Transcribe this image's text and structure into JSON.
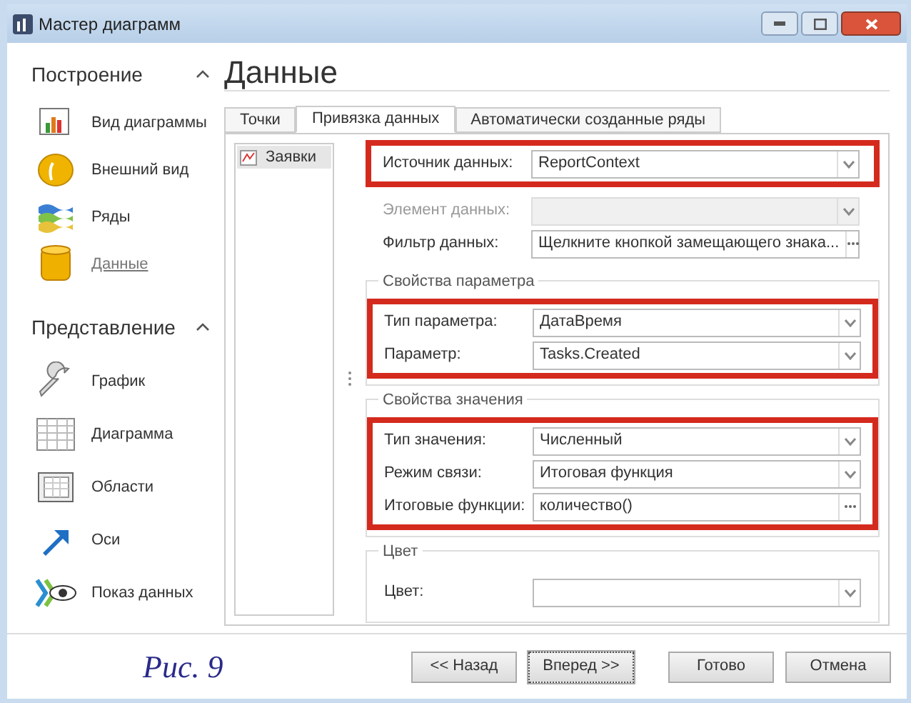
{
  "window": {
    "title": "Мастер диаграмм"
  },
  "sidebar": {
    "sections": [
      {
        "title": "Построение",
        "expanded": true,
        "items": [
          {
            "label": "Вид диаграммы",
            "selected": false
          },
          {
            "label": "Внешний вид",
            "selected": false
          },
          {
            "label": "Ряды",
            "selected": false
          },
          {
            "label": "Данные",
            "selected": true
          }
        ]
      },
      {
        "title": "Представление",
        "expanded": true,
        "items": [
          {
            "label": "График",
            "selected": false
          },
          {
            "label": "Диаграмма",
            "selected": false
          },
          {
            "label": "Области",
            "selected": false
          },
          {
            "label": "Оси",
            "selected": false
          },
          {
            "label": "Показ данных",
            "selected": false
          }
        ]
      }
    ]
  },
  "heading": "Данные",
  "tabs": [
    {
      "label": "Точки",
      "selected": false
    },
    {
      "label": "Привязка данных",
      "selected": true
    },
    {
      "label": "Автоматически созданные ряды",
      "selected": false
    }
  ],
  "series_list": [
    {
      "label": "Заявки",
      "selected": true
    }
  ],
  "form": {
    "sections": [
      {
        "groups": [
          {
            "highlighted": true,
            "fields": [
              {
                "label": "Источник данных:",
                "value": "ReportContext",
                "kind": "dropdown",
                "disabled": false
              }
            ]
          },
          {
            "highlighted": false,
            "fields": [
              {
                "label": "Элемент данных:",
                "kind": "dropdown",
                "disabled": true
              },
              {
                "label": "Фильтр данных:",
                "value": "Щелкните кнопкой замещающего знака...",
                "kind": "ellipsis",
                "disabled": false
              }
            ]
          }
        ]
      },
      {
        "title": "Свойства параметра",
        "groups": [
          {
            "highlighted": true,
            "fields": [
              {
                "label": "Тип параметра:",
                "value": "ДатаВремя",
                "kind": "dropdown",
                "disabled": false
              },
              {
                "label": "Параметр:",
                "value": "Tasks.Created",
                "kind": "dropdown",
                "disabled": false
              }
            ]
          }
        ]
      },
      {
        "title": "Свойства значения",
        "groups": [
          {
            "highlighted": true,
            "fields": [
              {
                "label": "Тип значения:",
                "value": "Численный",
                "kind": "dropdown",
                "disabled": false
              },
              {
                "label": "Режим связи:",
                "value": "Итоговая функция",
                "kind": "dropdown",
                "disabled": false
              },
              {
                "label": "Итоговые функции:",
                "value": "количество()",
                "kind": "ellipsis",
                "disabled": false
              }
            ]
          }
        ]
      },
      {
        "title": "Цвет",
        "groups": [
          {
            "highlighted": false,
            "fields": [
              {
                "label": "Цвет:",
                "kind": "dropdown",
                "disabled": false
              }
            ]
          }
        ]
      }
    ]
  },
  "caption": "Рис. 9",
  "buttons": [
    {
      "label": "<< Назад",
      "focused": false
    },
    {
      "label": "Вперед >>",
      "focused": true
    },
    {
      "label": "Готово",
      "focused": false
    },
    {
      "label": "Отмена",
      "focused": false
    }
  ]
}
